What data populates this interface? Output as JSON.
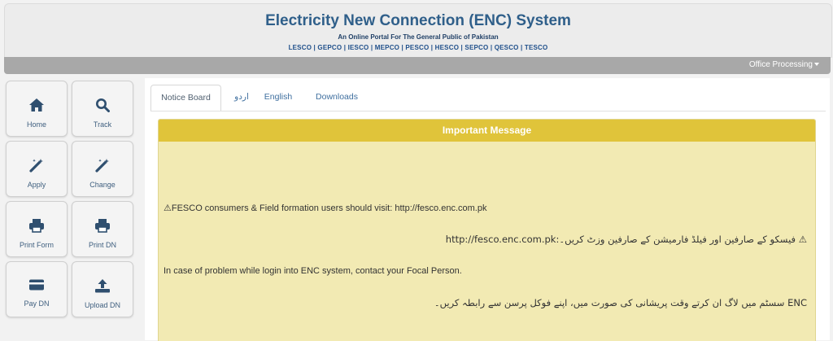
{
  "header": {
    "title": "Electricity New Connection (ENC) System",
    "subtitle": "An Online Portal For The General Public of Pakistan",
    "discos": "LESCO | GEPCO | IESCO | MEPCO | PESCO | HESCO | SEPCO | QESCO | TESCO"
  },
  "topbar": {
    "office_label": "Office Processing"
  },
  "sidebar": {
    "tiles": [
      {
        "label": "Home",
        "icon": "home-icon"
      },
      {
        "label": "Track",
        "icon": "search-icon"
      },
      {
        "label": "Apply",
        "icon": "magic-wand-icon"
      },
      {
        "label": "Change",
        "icon": "magic-wand-icon"
      },
      {
        "label": "Print Form",
        "icon": "printer-icon"
      },
      {
        "label": "Print DN",
        "icon": "printer-icon"
      },
      {
        "label": "Pay DN",
        "icon": "credit-card-icon"
      },
      {
        "label": "Upload DN",
        "icon": "upload-icon"
      }
    ]
  },
  "tabs": [
    {
      "label": "Notice Board",
      "active": true
    },
    {
      "label": "اردو"
    },
    {
      "label": "English"
    },
    {
      "label": "Downloads"
    }
  ],
  "notice": {
    "heading": "Important Message",
    "line1": "⚠FESCO consumers & Field formation users should visit: http://fesco.enc.com.pk",
    "line2": "⚠ فیسکو کے صارفین اور فیلڈ فارمیشن کے صارفین وزٹ کریں۔:http://fesco.enc.com.pk",
    "line3": "In case of problem while login into ENC system, contact your Focal Person.",
    "line4": "ENC سسٹم میں لاگ ان کرتے وقت پریشانی کی صورت میں، اپنے فوکل پرسن سے رابطہ کریں۔"
  },
  "colors": {
    "title": "#2f5f8a",
    "panel_header": "#e0c43a",
    "panel_body": "#f2eab3",
    "icon": "#2f4f6f"
  }
}
